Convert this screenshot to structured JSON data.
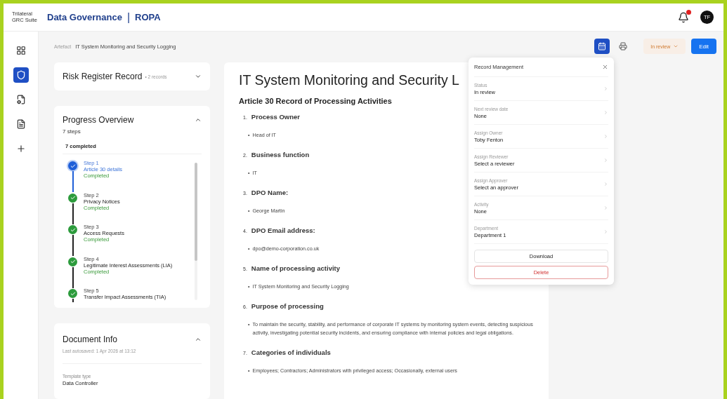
{
  "header": {
    "logo": [
      "Trilateral",
      "GRC Suite"
    ],
    "title": "Data Governance",
    "separator": "|",
    "module": "ROPA",
    "notifications": {
      "unread": true
    },
    "avatar": "TF"
  },
  "rail": [
    {
      "kind": "grid",
      "selected": false
    },
    {
      "kind": "shield",
      "selected": true
    },
    {
      "kind": "doc-gear",
      "selected": false
    },
    {
      "kind": "doc",
      "selected": false
    },
    {
      "kind": "plus",
      "selected": false
    }
  ],
  "breadcrumb": {
    "parent": "Artefact",
    "current": "IT System Monitoring and Security Logging"
  },
  "toolbar": {
    "icons": [
      {
        "kind": "calendar",
        "selected": true
      },
      {
        "kind": "printer",
        "selected": false
      }
    ],
    "status": "In review",
    "edit": "Edit"
  },
  "risk_card": {
    "title": "Risk Register Record",
    "count": "• 2 records",
    "expanded": false
  },
  "progress": {
    "title": "Progress Overview",
    "steps_count": "7 steps",
    "completed": "7 completed",
    "expanded": true,
    "steps": [
      {
        "step": "Step 1",
        "name": "Article 30 details",
        "status": "Completed",
        "selected": true
      },
      {
        "step": "Step 2",
        "name": "Privacy Notices",
        "status": "Completed",
        "selected": false
      },
      {
        "step": "Step 3",
        "name": "Access Requests",
        "status": "Completed",
        "selected": false
      },
      {
        "step": "Step 4",
        "name": "Legitimate Interest Assessments (LIA)",
        "status": "Completed",
        "selected": false
      },
      {
        "step": "Step 5",
        "name": "Transfer Impact Assessments (TIA)",
        "selected": false
      }
    ]
  },
  "doc_info": {
    "title": "Document Info",
    "autosaved": "Last autosaved: 1 Apr 2026 at 13:12",
    "expanded": true,
    "fields": [
      {
        "label": "Template type",
        "value": "Data Controller"
      }
    ]
  },
  "document": {
    "title": "IT System Monitoring and Security L",
    "subtitle": "Article 30 Record of Processing Activities",
    "items": [
      {
        "number": "1.",
        "heading": "Process Owner",
        "bullet": "•",
        "value": "Head of IT"
      },
      {
        "number": "2.",
        "heading": "Business function",
        "bullet": "•",
        "value": "IT"
      },
      {
        "number": "3.",
        "heading": "DPO Name:",
        "bullet": "•",
        "value": "George Martin"
      },
      {
        "number": "4.",
        "heading": "DPO Email address:",
        "bullet": "•",
        "value": "dpo@demo-corporation.co.uk"
      },
      {
        "number": "5.",
        "heading": "Name of processing activity",
        "bullet": "•",
        "value": "IT System Monitoring and Security Logging"
      },
      {
        "number": "6.",
        "heading": "Purpose of processing",
        "bullet": "•",
        "value": "To maintain the security, stability, and performance of corporate IT systems by monitoring system events, detecting suspicious activity, investigating potential security incidents, and ensuring compliance with internal policies and legal obligations."
      },
      {
        "number": "7.",
        "heading": "Categories of individuals",
        "bullet": "•",
        "value": "Employees; Contractors; Administrators with privileged access; Occasionally, external users"
      }
    ]
  },
  "record_management": {
    "title": "Record Management",
    "fields": [
      {
        "label": "Status",
        "value": "In review"
      },
      {
        "label": "Next review date",
        "value": "None"
      },
      {
        "label": "Assign Owner",
        "value": "Toby Fenton"
      },
      {
        "label": "Assign Reviewer",
        "value": "Select a reviewer"
      },
      {
        "label": "Assign Approver",
        "value": "Select an approver"
      },
      {
        "label": "Activity",
        "value": "None"
      },
      {
        "label": "Department",
        "value": "Department 1"
      }
    ],
    "download": "Download",
    "delete": "Delete"
  }
}
